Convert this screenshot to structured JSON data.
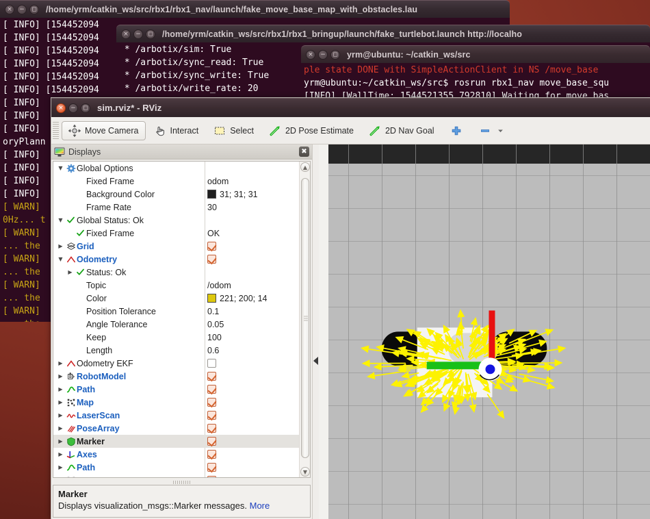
{
  "desktop": {
    "background_color": "#8d3526"
  },
  "windows": {
    "terminal_launch_map": {
      "title": "/home/yrm/catkin_ws/src/rbx1/rbx1_nav/launch/fake_move_base_map_with_obstacles.lau",
      "lines": [
        {
          "text": "[ INFO] [154452094",
          "cls": "info"
        },
        {
          "text": "[ INFO] [154452094",
          "cls": "info"
        },
        {
          "text": "[ INFO] [154452094",
          "cls": "info"
        },
        {
          "text": "[ INFO] [154452094",
          "cls": "info"
        },
        {
          "text": "[ INFO] [154452094",
          "cls": "info"
        },
        {
          "text": "[ INFO] [154452094",
          "cls": "info"
        },
        {
          "text": "[ INFO]",
          "cls": "info"
        },
        {
          "text": "[ INFO]",
          "cls": "info"
        },
        {
          "text": "[ INFO]",
          "cls": "info"
        },
        {
          "text": "oryPlann",
          "cls": "info"
        },
        {
          "text": "[ INFO]",
          "cls": "info"
        },
        {
          "text": "[ INFO]",
          "cls": "info"
        },
        {
          "text": "[ INFO]",
          "cls": "info"
        },
        {
          "text": "[ INFO]",
          "cls": "info"
        },
        {
          "text": "[ WARN]",
          "cls": "warn"
        },
        {
          "text": "0Hz... t",
          "cls": "warn"
        },
        {
          "text": "[ WARN]",
          "cls": "warn"
        },
        {
          "text": "... the",
          "cls": "warn"
        },
        {
          "text": "[ WARN]",
          "cls": "warn"
        },
        {
          "text": "... the",
          "cls": "warn"
        },
        {
          "text": "[ WARN]",
          "cls": "warn"
        },
        {
          "text": "... the",
          "cls": "warn"
        },
        {
          "text": "[ WARN]",
          "cls": "warn"
        },
        {
          "text": "... the",
          "cls": "warn"
        }
      ]
    },
    "terminal_bringup": {
      "title": "/home/yrm/catkin_ws/src/rbx1/rbx1_bringup/launch/fake_turtlebot.launch http://localho",
      "lines": [
        {
          "text": " * /arbotix/sim: True",
          "cls": "info"
        },
        {
          "text": " * /arbotix/sync_read: True",
          "cls": "info"
        },
        {
          "text": " * /arbotix/sync_write: True",
          "cls": "info"
        },
        {
          "text": " * /arbotix/write_rate: 20",
          "cls": "info"
        }
      ]
    },
    "terminal_shell": {
      "title": "yrm@ubuntu: ~/catkin_ws/src",
      "lines": [
        {
          "text": "ple state DONE with SimpleActionClient in NS /move_base",
          "cls": "err"
        },
        {
          "text": "yrm@ubuntu:~/catkin_ws/src$ rosrun rbx1_nav move_base_squ",
          "cls": "info"
        },
        {
          "text": "[INFO] [WallTime: 1544521355.792810] Waiting for move_bas",
          "cls": "info"
        }
      ]
    }
  },
  "rviz": {
    "title": "sim.rviz* - RViz",
    "toolbar": [
      {
        "label": "Move Camera",
        "icon": "move-camera-icon",
        "active": true
      },
      {
        "label": "Interact",
        "icon": "interact-hand-icon",
        "active": false
      },
      {
        "label": "Select",
        "icon": "select-marquee-icon",
        "active": false
      },
      {
        "label": "2D Pose Estimate",
        "icon": "pose-estimate-arrow-icon",
        "active": false
      },
      {
        "label": "2D Nav Goal",
        "icon": "nav-goal-arrow-icon",
        "active": false
      }
    ],
    "toolbar_extra": {
      "add_tool_label": "+",
      "remove_tool_label": "−",
      "dropdown_label": "▾"
    },
    "displays_panel": {
      "title": "Displays",
      "close_label": "✖",
      "rows": [
        {
          "arrow": "▼",
          "icon": "gear-icon",
          "label": "Global Options",
          "style": "plain",
          "indent": 0,
          "value_text": ""
        },
        {
          "arrow": "",
          "icon": "",
          "label": "Fixed Frame",
          "style": "plain",
          "indent": 1,
          "value_text": "odom"
        },
        {
          "arrow": "",
          "icon": "",
          "label": "Background Color",
          "style": "plain",
          "indent": 1,
          "value_text": "31; 31; 31",
          "swatch": "#1f1f1f"
        },
        {
          "arrow": "",
          "icon": "",
          "label": "Frame Rate",
          "style": "plain",
          "indent": 1,
          "value_text": "30"
        },
        {
          "arrow": "▼",
          "icon": "check-icon",
          "label": "Global Status: Ok",
          "style": "plain",
          "indent": 0,
          "value_text": ""
        },
        {
          "arrow": "",
          "icon": "check-icon",
          "label": "Fixed Frame",
          "style": "plain",
          "indent": 1,
          "value_text": "OK"
        },
        {
          "arrow": "▶",
          "icon": "grid-icon",
          "label": "Grid",
          "style": "link",
          "indent": 0,
          "checkbox": "on"
        },
        {
          "arrow": "▼",
          "icon": "odometry-icon",
          "label": "Odometry",
          "style": "link",
          "indent": 0,
          "checkbox": "on"
        },
        {
          "arrow": "▶",
          "icon": "check-icon",
          "label": "Status: Ok",
          "style": "plain",
          "indent": 1,
          "value_text": ""
        },
        {
          "arrow": "",
          "icon": "",
          "label": "Topic",
          "style": "plain",
          "indent": 1,
          "value_text": "/odom"
        },
        {
          "arrow": "",
          "icon": "",
          "label": "Color",
          "style": "plain",
          "indent": 1,
          "value_text": "221; 200; 14",
          "swatch": "#ddc80e"
        },
        {
          "arrow": "",
          "icon": "",
          "label": "Position Tolerance",
          "style": "plain",
          "indent": 1,
          "value_text": "0.1"
        },
        {
          "arrow": "",
          "icon": "",
          "label": "Angle Tolerance",
          "style": "plain",
          "indent": 1,
          "value_text": "0.05"
        },
        {
          "arrow": "",
          "icon": "",
          "label": "Keep",
          "style": "plain",
          "indent": 1,
          "value_text": "100"
        },
        {
          "arrow": "",
          "icon": "",
          "label": "Length",
          "style": "plain",
          "indent": 1,
          "value_text": "0.6"
        },
        {
          "arrow": "▶",
          "icon": "odometry-icon",
          "label": "Odometry EKF",
          "style": "plain",
          "indent": 0,
          "checkbox": "off"
        },
        {
          "arrow": "▶",
          "icon": "robotmodel-icon",
          "label": "RobotModel",
          "style": "link",
          "indent": 0,
          "checkbox": "on"
        },
        {
          "arrow": "▶",
          "icon": "path-icon",
          "label": "Path",
          "style": "link",
          "indent": 0,
          "checkbox": "on"
        },
        {
          "arrow": "▶",
          "icon": "map-icon",
          "label": "Map",
          "style": "link",
          "indent": 0,
          "checkbox": "on"
        },
        {
          "arrow": "▶",
          "icon": "laserscan-icon",
          "label": "LaserScan",
          "style": "link",
          "indent": 0,
          "checkbox": "on"
        },
        {
          "arrow": "▶",
          "icon": "posearray-icon",
          "label": "PoseArray",
          "style": "link",
          "indent": 0,
          "checkbox": "on"
        },
        {
          "arrow": "▶",
          "icon": "marker-icon",
          "label": "Marker",
          "style": "bold",
          "indent": 0,
          "checkbox": "on",
          "selected": true
        },
        {
          "arrow": "▶",
          "icon": "axes-icon",
          "label": "Axes",
          "style": "link",
          "indent": 0,
          "checkbox": "on"
        },
        {
          "arrow": "▶",
          "icon": "path-icon",
          "label": "Path",
          "style": "link",
          "indent": 0,
          "checkbox": "on"
        },
        {
          "arrow": "▶",
          "icon": "map-icon",
          "label": "Map",
          "style": "link",
          "indent": 0,
          "checkbox": "on"
        }
      ]
    },
    "description": {
      "title": "Marker",
      "text": "Displays visualization_msgs::Marker messages. ",
      "more_link": "More"
    }
  }
}
